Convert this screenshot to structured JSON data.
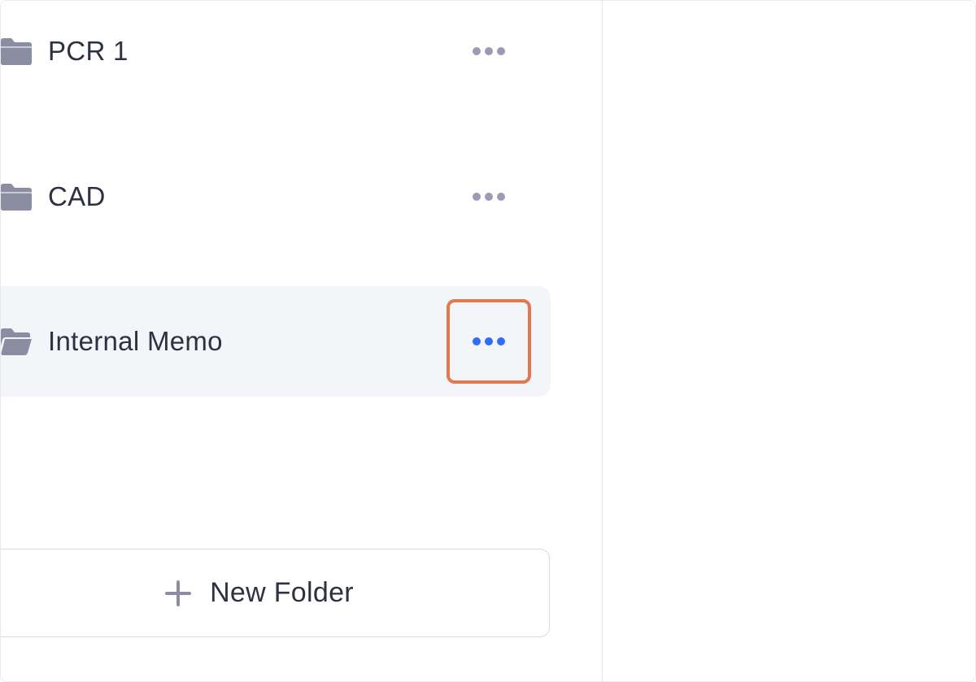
{
  "folders": [
    {
      "name": "PCR 1",
      "icon": "folder-icon",
      "selected": false
    },
    {
      "name": "CAD",
      "icon": "folder-icon",
      "selected": false
    },
    {
      "name": "Internal Memo",
      "icon": "folder-icon",
      "selected": true
    }
  ],
  "new_folder": {
    "label": "New Folder",
    "icon": "plus-icon"
  },
  "colors": {
    "text": "#2d3142",
    "icon": "#8b8ea3",
    "dots_inactive": "#9a9cb1",
    "dots_active": "#2f6df6",
    "highlight_border": "#e07a4e",
    "selected_row_bg": "#f4f5f9"
  }
}
